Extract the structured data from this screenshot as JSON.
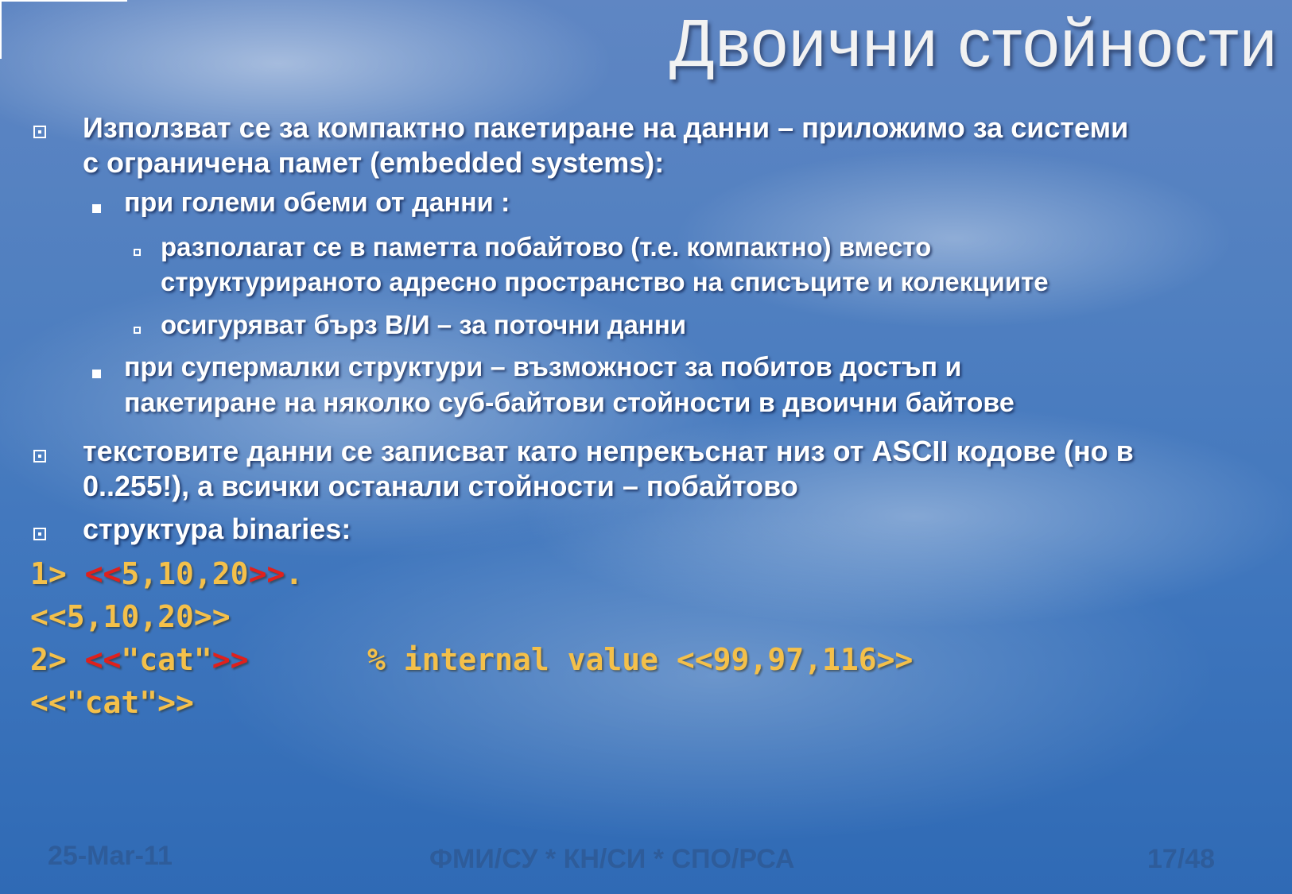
{
  "title": "Двоични стойности",
  "bullets": [
    {
      "lines": [
        "Използват се за компактно пакетиране на данни – приложимо за системи",
        "с ограничена памет (embedded systems):"
      ]
    },
    {
      "lines": [
        "при големи обеми от данни :"
      ]
    },
    {
      "lines": [
        "разполагат се в паметта побайтово (т.е. компактно) вместо",
        "структурираното адресно пространство на списъците и колекциите"
      ]
    },
    {
      "lines": [
        "осигуряват бърз В/И – за поточни данни"
      ]
    },
    {
      "lines": [
        "при супермалки структури – възможност за побитов достъп и",
        "пакетиране на няколко суб-байтови стойности в  двоични байтове"
      ]
    },
    {
      "lines": [
        "текстовите данни се записват като непрекъснат низ от ASCII кодове (но в",
        "0..255!), а всички останали стойности –  побайтово"
      ]
    },
    {
      "lines": [
        "структура binaries:"
      ]
    }
  ],
  "code": {
    "line1": {
      "prompt": "1> ",
      "open": "<<",
      "body": "5,10,20",
      "close": ">>",
      "end": "."
    },
    "line2": "<<5,10,20>>",
    "line3": {
      "prompt": "2> ",
      "open": "<<",
      "body": "\"cat\"",
      "close": ">>",
      "comment": "% internal value <<99,97,116>>"
    },
    "line4": "<<\"cat\">>"
  },
  "footer": {
    "date": "25-Mar-11",
    "center": "ФМИ/СУ   *   КН/СИ   *   СПО/РСА",
    "page": "17/48"
  },
  "colors": {
    "code_text": "#f4c04a",
    "code_brackets": "#e0201c",
    "footer_text": "#2e5c9a"
  }
}
